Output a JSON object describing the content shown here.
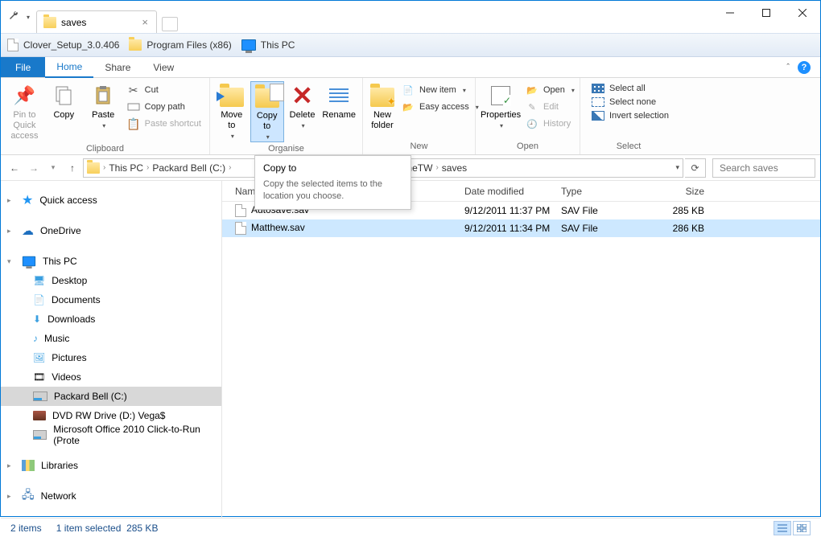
{
  "window": {
    "active_tab_title": "saves"
  },
  "bookmarks": [
    {
      "label": "Clover_Setup_3.0.406",
      "icon": "file"
    },
    {
      "label": "Program Files (x86)",
      "icon": "folder"
    },
    {
      "label": "This PC",
      "icon": "pc"
    }
  ],
  "ribbon_tabs": {
    "file": "File",
    "home": "Home",
    "share": "Share",
    "view": "View"
  },
  "ribbon": {
    "clipboard": {
      "label": "Clipboard",
      "pin": "Pin to Quick access",
      "copy": "Copy",
      "paste": "Paste",
      "cut": "Cut",
      "copy_path": "Copy path",
      "paste_shortcut": "Paste shortcut"
    },
    "organise": {
      "label": "Organise",
      "move_to": "Move to",
      "copy_to": "Copy to",
      "delete": "Delete",
      "rename": "Rename"
    },
    "new": {
      "label": "New",
      "new_folder": "New folder",
      "new_item": "New item",
      "easy_access": "Easy access"
    },
    "open": {
      "label": "Open",
      "properties": "Properties",
      "open": "Open",
      "edit": "Edit",
      "history": "History"
    },
    "select": {
      "label": "Select",
      "all": "Select all",
      "none": "Select none",
      "invert": "Invert selection"
    }
  },
  "tooltip": {
    "title": "Copy to",
    "body": "Copy the selected items to the location you choose."
  },
  "breadcrumbs": [
    "This PC",
    "Packard Bell (C:)",
    "neTW",
    "saves"
  ],
  "breadcrumb_partial_visible": "neTW",
  "search": {
    "placeholder": "Search saves"
  },
  "sidebar": {
    "quick_access": "Quick access",
    "onedrive": "OneDrive",
    "this_pc": "This PC",
    "children": [
      "Desktop",
      "Documents",
      "Downloads",
      "Music",
      "Pictures",
      "Videos",
      "Packard Bell (C:)",
      "DVD RW Drive (D:) Vega$",
      "Microsoft Office 2010 Click-to-Run (Prote"
    ],
    "libraries": "Libraries",
    "network": "Network"
  },
  "columns": {
    "name": "Name",
    "date": "Date modified",
    "type": "Type",
    "size": "Size"
  },
  "files": [
    {
      "name": "Autosave.sav",
      "date": "9/12/2011 11:37 PM",
      "type": "SAV File",
      "size": "285 KB",
      "selected": false
    },
    {
      "name": "Matthew.sav",
      "date": "9/12/2011 11:34 PM",
      "type": "SAV File",
      "size": "286 KB",
      "selected": true
    }
  ],
  "statusbar": {
    "count": "2 items",
    "selection": "1 item selected",
    "sel_size": "285 KB"
  }
}
